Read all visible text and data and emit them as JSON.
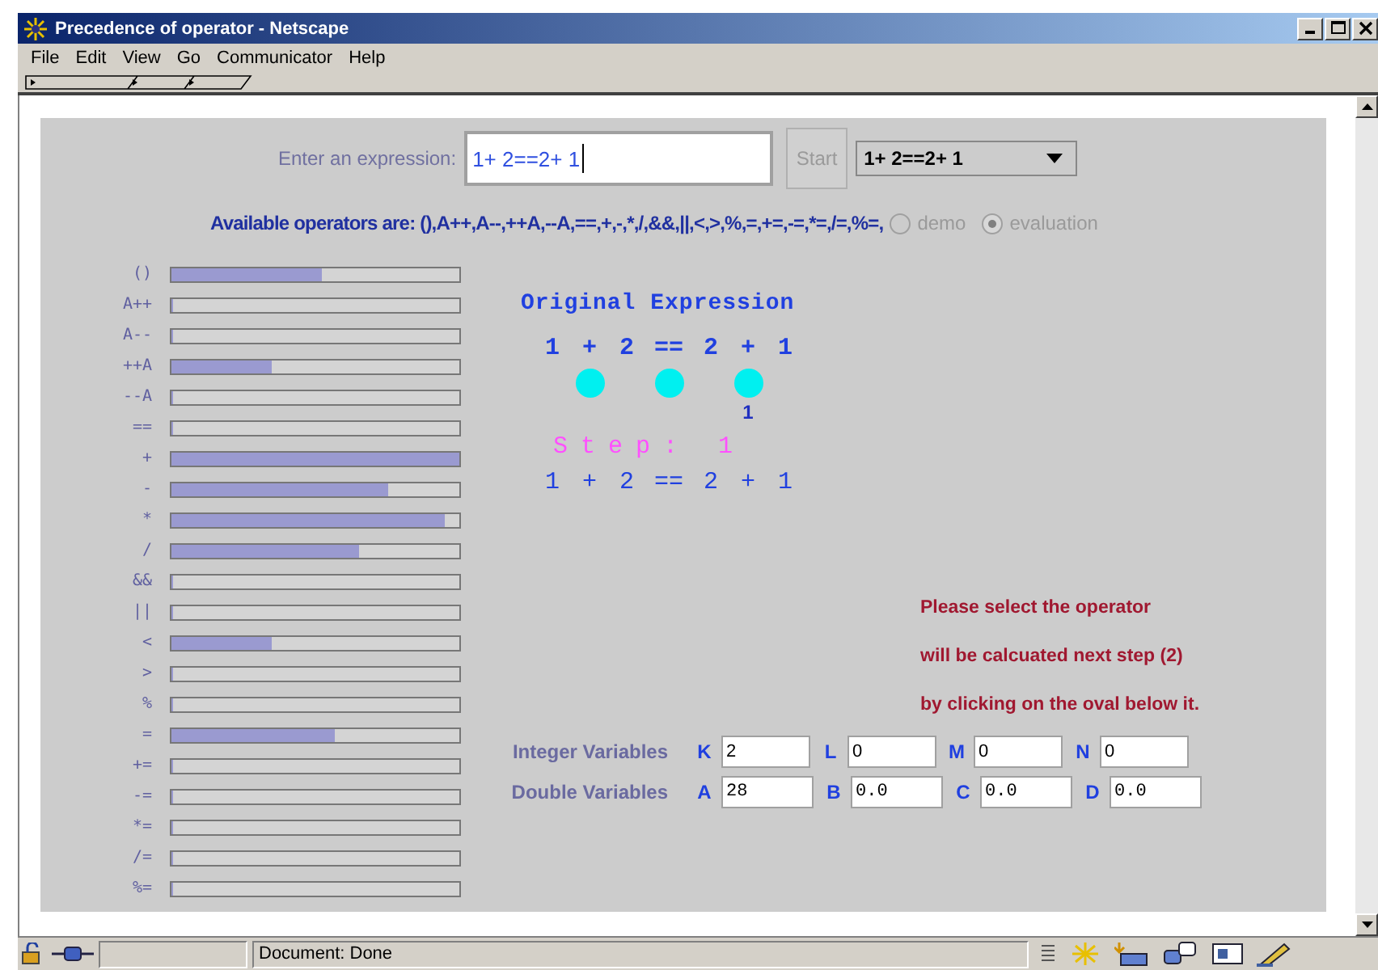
{
  "window": {
    "title": "Precedence of operator - Netscape"
  },
  "menu": [
    {
      "label": "File"
    },
    {
      "label": "Edit"
    },
    {
      "label": "View"
    },
    {
      "label": "Go"
    },
    {
      "label": "Communicator"
    },
    {
      "label": "Help"
    }
  ],
  "input_row": {
    "label": "Enter an expression:",
    "value": "1+ 2==2+ 1",
    "button": "Start",
    "dropdown": "1+ 2==2+ 1"
  },
  "operators_line": "Available operators are: (),A++,A--,++A,--A,==,+,-,*,/,&&,||,<,>,%,=,+=,-=,*=,/=,%=,",
  "modes": [
    {
      "label": "demo",
      "selected": false,
      "disabled": true
    },
    {
      "label": "evaluation",
      "selected": true,
      "disabled": true
    }
  ],
  "operators": [
    {
      "label": "()",
      "level": 0.52
    },
    {
      "label": "A++",
      "level": 0
    },
    {
      "label": "A--",
      "level": 0
    },
    {
      "label": "++A",
      "level": 0.35
    },
    {
      "label": "--A",
      "level": 0
    },
    {
      "label": "==",
      "level": 0
    },
    {
      "label": "+",
      "level": 1
    },
    {
      "label": "-",
      "level": 0.75
    },
    {
      "label": "*",
      "level": 0.95
    },
    {
      "label": "/",
      "level": 0.65
    },
    {
      "label": "&&",
      "level": 0
    },
    {
      "label": "||",
      "level": 0
    },
    {
      "label": "<",
      "level": 0.35
    },
    {
      "label": ">",
      "level": 0
    },
    {
      "label": "%",
      "level": 0
    },
    {
      "label": "=",
      "level": 0.57
    },
    {
      "label": "+=",
      "level": 0
    },
    {
      "label": "-=",
      "level": 0
    },
    {
      "label": "*=",
      "level": 0
    },
    {
      "label": "/=",
      "level": 0
    },
    {
      "label": "%=",
      "level": 0
    }
  ],
  "expression": {
    "title": "Original Expression",
    "tokens": [
      {
        "text": "1",
        "kind": "operand"
      },
      {
        "text": "+",
        "kind": "operator"
      },
      {
        "text": "2",
        "kind": "operand"
      },
      {
        "text": "==",
        "kind": "operator"
      },
      {
        "text": "2",
        "kind": "operand"
      },
      {
        "text": "+",
        "kind": "operator",
        "oval_label": "1"
      },
      {
        "text": "1",
        "kind": "operand"
      }
    ],
    "step": "Step: 1",
    "result_tokens": [
      "1",
      "+",
      "2",
      "==",
      "2",
      "+",
      "1"
    ]
  },
  "message": [
    "Please select the operator",
    "will be calcuated next step (2)",
    "by clicking on the oval below it."
  ],
  "variable_rows": [
    {
      "label": "Integer Variables",
      "vars": [
        {
          "name": "K",
          "value": "2"
        },
        {
          "name": "L",
          "value": "0"
        },
        {
          "name": "M",
          "value": "0"
        },
        {
          "name": "N",
          "value": "0"
        }
      ]
    },
    {
      "label": "Double Variables",
      "vars": [
        {
          "name": "A",
          "value": "28"
        },
        {
          "name": "B",
          "value": "0.0"
        },
        {
          "name": "C",
          "value": "0.0"
        },
        {
          "name": "D",
          "value": "0.0"
        }
      ]
    }
  ],
  "status_bar": {
    "text": "Document: Done"
  }
}
